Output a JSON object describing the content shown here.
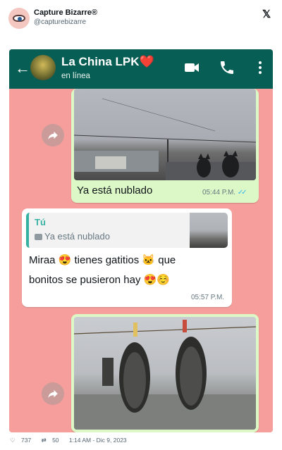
{
  "post": {
    "display_name": "Capture Bizarre®",
    "handle": "@capturebizarre"
  },
  "chat": {
    "contact_name": "La China LPK❤️",
    "contact_status": "en línea",
    "messages": [
      {
        "caption": "Ya está nublado",
        "time": "05:44 P.M."
      },
      {
        "quote_author": "Tú",
        "quote_text": "Ya está nublado",
        "line1": "Miraa 😍 tienes gatitios 🐱 que",
        "line2": "bonitos se pusieron hay 😍☺️",
        "time": "05:57 P.M."
      }
    ]
  },
  "footer": {
    "likes": "737",
    "retweets": "50",
    "timestamp": "1:14 AM - Dic 9, 2023"
  },
  "colors": {
    "whatsapp_header": "#075e54",
    "outgoing_bubble": "#dcf8c6",
    "chat_background": "#f59e9b",
    "quote_accent": "#35b1a4",
    "read_ticks": "#34b7f1"
  }
}
